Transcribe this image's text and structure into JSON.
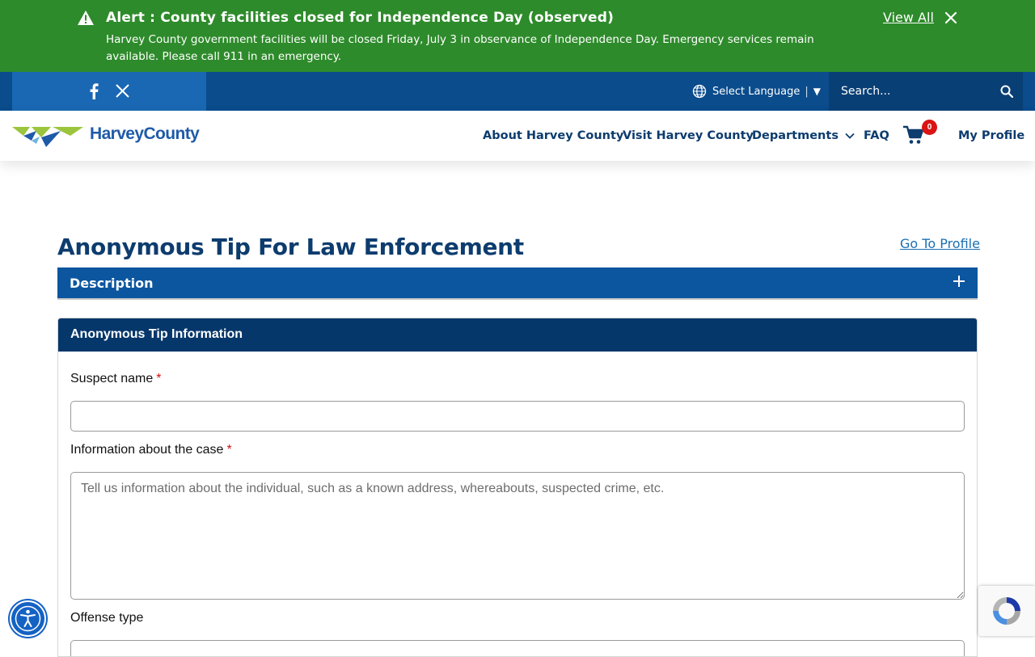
{
  "alert": {
    "title": "Alert : County facilities closed for Independence Day (observed)",
    "body": "Harvey County government facilities will be closed Friday, July 3 in observance of Independence Day. Emergency services remain available. Please call 911 in an emergency.",
    "view_all": "View All"
  },
  "utility": {
    "language_label": "Select Language",
    "language_caret": "▼",
    "search_placeholder": "Search..."
  },
  "header": {
    "logo_text": "HarveyCounty",
    "nav": [
      {
        "label": "About Harvey County"
      },
      {
        "label": "Visit Harvey County"
      },
      {
        "label": "Departments"
      },
      {
        "label": "FAQ"
      },
      {
        "label": "My Profile"
      }
    ],
    "cart_count": "0"
  },
  "main": {
    "title": "Anonymous Tip For Law Enforcement",
    "go_to_profile": "Go To Profile",
    "accordion_label": "Description",
    "form": {
      "section_title": "Anonymous Tip Information",
      "suspect_label": "Suspect name",
      "info_label": "Information about the case",
      "info_placeholder": "Tell us information about the individual, such as a known address, whereabouts, suspected crime, etc.",
      "offense_label": "Offense type",
      "required_mark": "*"
    }
  },
  "colors": {
    "alert_green": "#2e8b2b",
    "utility_blue": "#0a4c8c",
    "nav_text": "#0d3c6e",
    "accordion_blue": "#0c56a0",
    "panel_head": "#06376a",
    "badge_red": "#d91414"
  }
}
